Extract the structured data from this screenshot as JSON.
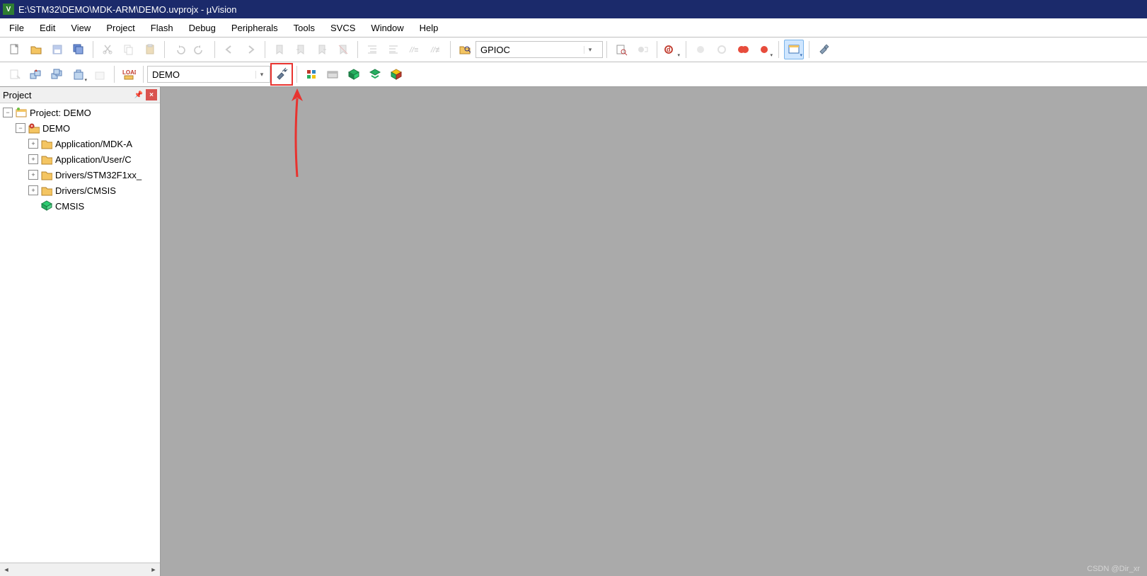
{
  "title": "E:\\STM32\\DEMO\\MDK-ARM\\DEMO.uvprojx - µVision",
  "menus": [
    "File",
    "Edit",
    "View",
    "Project",
    "Flash",
    "Debug",
    "Peripherals",
    "Tools",
    "SVCS",
    "Window",
    "Help"
  ],
  "toolbar1": {
    "search_combo": "GPIOC"
  },
  "toolbar2": {
    "target_combo": "DEMO"
  },
  "project_panel": {
    "title": "Project",
    "tree": {
      "root": "Project: DEMO",
      "target": "DEMO",
      "groups": [
        "Application/MDK-A",
        "Application/User/C",
        "Drivers/STM32F1xx_",
        "Drivers/CMSIS"
      ],
      "component": "CMSIS"
    }
  },
  "watermark": "CSDN @Dir_xr"
}
